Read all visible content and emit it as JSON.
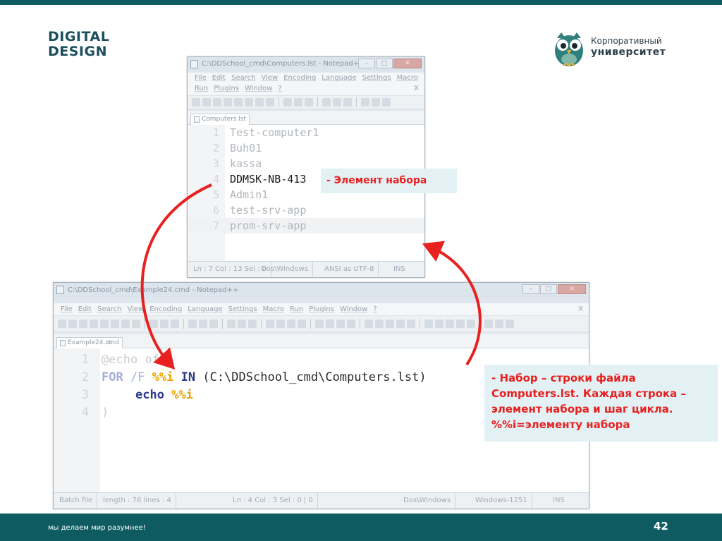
{
  "logos": {
    "left_line1": "DIGITAL",
    "left_line2": "DESIGN",
    "right_line1": "Корпоративный",
    "right_line2": "университет"
  },
  "window1": {
    "title": "C:\\DDSchool_cmd\\Computers.lst - Notepad++",
    "menu_row1": [
      "File",
      "Edit",
      "Search",
      "View",
      "Encoding",
      "Language",
      "Settings",
      "Macro"
    ],
    "menu_row2": [
      "Run",
      "Plugins",
      "Window",
      "?"
    ],
    "close_x": "X",
    "tab": "Computers.lst",
    "lines": [
      {
        "n": "1",
        "text": "Test-computer1"
      },
      {
        "n": "2",
        "text": "Buh01"
      },
      {
        "n": "3",
        "text": "kassa"
      },
      {
        "n": "4",
        "text": "DDMSK-NB-413"
      },
      {
        "n": "5",
        "text": "Admin1"
      },
      {
        "n": "6",
        "text": "test-srv-app"
      },
      {
        "n": "7",
        "text": "prom-srv-app"
      }
    ],
    "status": {
      "pos": "Ln : 7    Col : 13    Sel : 0",
      "eol": "Dos\\Windows",
      "enc": "ANSI as UTF-8",
      "ins": "INS"
    }
  },
  "window2": {
    "title": "C:\\DDSchool_cmd\\Example24.cmd - Notepad++",
    "menu": [
      "File",
      "Edit",
      "Search",
      "View",
      "Encoding",
      "Language",
      "Settings",
      "Macro",
      "Run",
      "Plugins",
      "Window",
      "?"
    ],
    "close_x": "X",
    "tab": "Example24.cmd",
    "line_numbers": [
      "1",
      "2",
      "3",
      "4"
    ],
    "code": {
      "l1_at": "@",
      "l1_cmd": "echo",
      "l1_rest": " of",
      "l2_for": "FOR",
      "l2_f": " /F ",
      "l2_var": "%%i",
      "l2_in": " IN",
      "l2_rest": " (C:\\DDSchool_cmd\\Computers.lst)",
      "l3_cmd": "echo",
      "l3_var": "%%i",
      "l4": ")"
    },
    "status": {
      "type": "Batch file",
      "length": "length : 76    lines : 4",
      "pos": "Ln : 4    Col : 3    Sel : 0 | 0",
      "eol": "Dos\\Windows",
      "enc": "Windows-1251",
      "ins": "INS"
    }
  },
  "callouts": {
    "element": "- Элемент набора",
    "set_lines": [
      "- Набор – строки файла",
      "Computers.lst. Каждая строка –",
      "элемент набора и шаг цикла.",
      "%%i=элементу набора"
    ]
  },
  "footer": {
    "slogan": "мы делаем мир разумнее!",
    "page": "42"
  },
  "colors": {
    "brand": "#0e5c62",
    "callout_text": "#e8201f",
    "callout_bg": "#e3f1f5",
    "variable": "#e8a400",
    "keyword": "#2b3a8c"
  }
}
